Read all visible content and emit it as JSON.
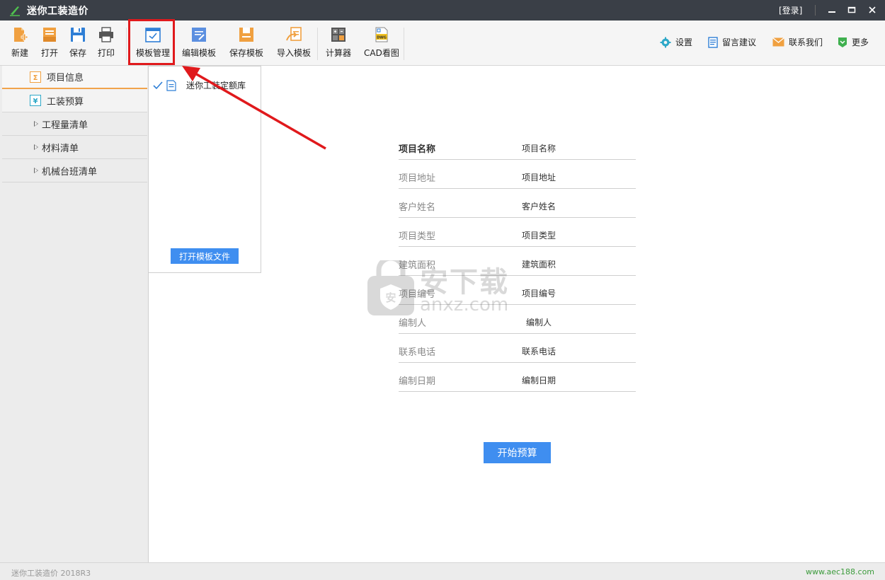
{
  "window": {
    "title": "迷你工装造价",
    "login_label": "[登录]"
  },
  "toolbar": {
    "buttons": [
      {
        "label": "新建",
        "icon": "new-file-icon"
      },
      {
        "label": "打开",
        "icon": "open-folder-icon"
      },
      {
        "label": "保存",
        "icon": "save-disk-icon"
      },
      {
        "label": "打印",
        "icon": "printer-icon"
      },
      {
        "label": "模板管理",
        "icon": "template-manage-icon"
      },
      {
        "label": "编辑模板",
        "icon": "edit-template-icon"
      },
      {
        "label": "保存模板",
        "icon": "save-template-icon"
      },
      {
        "label": "导入模板",
        "icon": "import-template-icon"
      },
      {
        "label": "计算器",
        "icon": "calculator-icon"
      },
      {
        "label": "CAD看图",
        "icon": "dwg-viewer-icon"
      }
    ],
    "right": [
      {
        "label": "设置",
        "icon": "gear-icon"
      },
      {
        "label": "留言建议",
        "icon": "feedback-icon"
      },
      {
        "label": "联系我们",
        "icon": "mail-icon"
      },
      {
        "label": "更多",
        "icon": "more-icon"
      }
    ]
  },
  "sidebar": {
    "items": [
      {
        "label": "项目信息",
        "icon": "sigma-icon"
      },
      {
        "label": "工装预算",
        "icon": "yen-icon"
      },
      {
        "label": "工程量清单"
      },
      {
        "label": "材料清单"
      },
      {
        "label": "机械台班清单"
      }
    ]
  },
  "dropdown": {
    "item_label": "迷你工装定额库",
    "open_button": "打开模板文件"
  },
  "form": {
    "fields": [
      {
        "label": "项目名称",
        "value": "项目名称"
      },
      {
        "label": "项目地址",
        "value": "项目地址"
      },
      {
        "label": "客户姓名",
        "value": "客户姓名"
      },
      {
        "label": "项目类型",
        "value": "项目类型"
      },
      {
        "label": "建筑面积",
        "value": "建筑面积"
      },
      {
        "label": "项目编号",
        "value": "项目编号"
      },
      {
        "label": "编制人",
        "value": "编制人"
      },
      {
        "label": "联系电话",
        "value": "联系电话"
      },
      {
        "label": "编制日期",
        "value": "编制日期"
      }
    ],
    "start_button": "开始预算"
  },
  "watermark": {
    "cn": "安下载",
    "en": "anxz.com"
  },
  "status": {
    "version": "迷你工装造价 2018R3",
    "url": "www.aec188.com"
  },
  "colors": {
    "titlebar": "#3a3f47",
    "accent_blue": "#3f8ef0",
    "highlight_red": "#e0191c",
    "active_tab_orange": "#f1a44c",
    "url_green": "#3c9b3c"
  }
}
